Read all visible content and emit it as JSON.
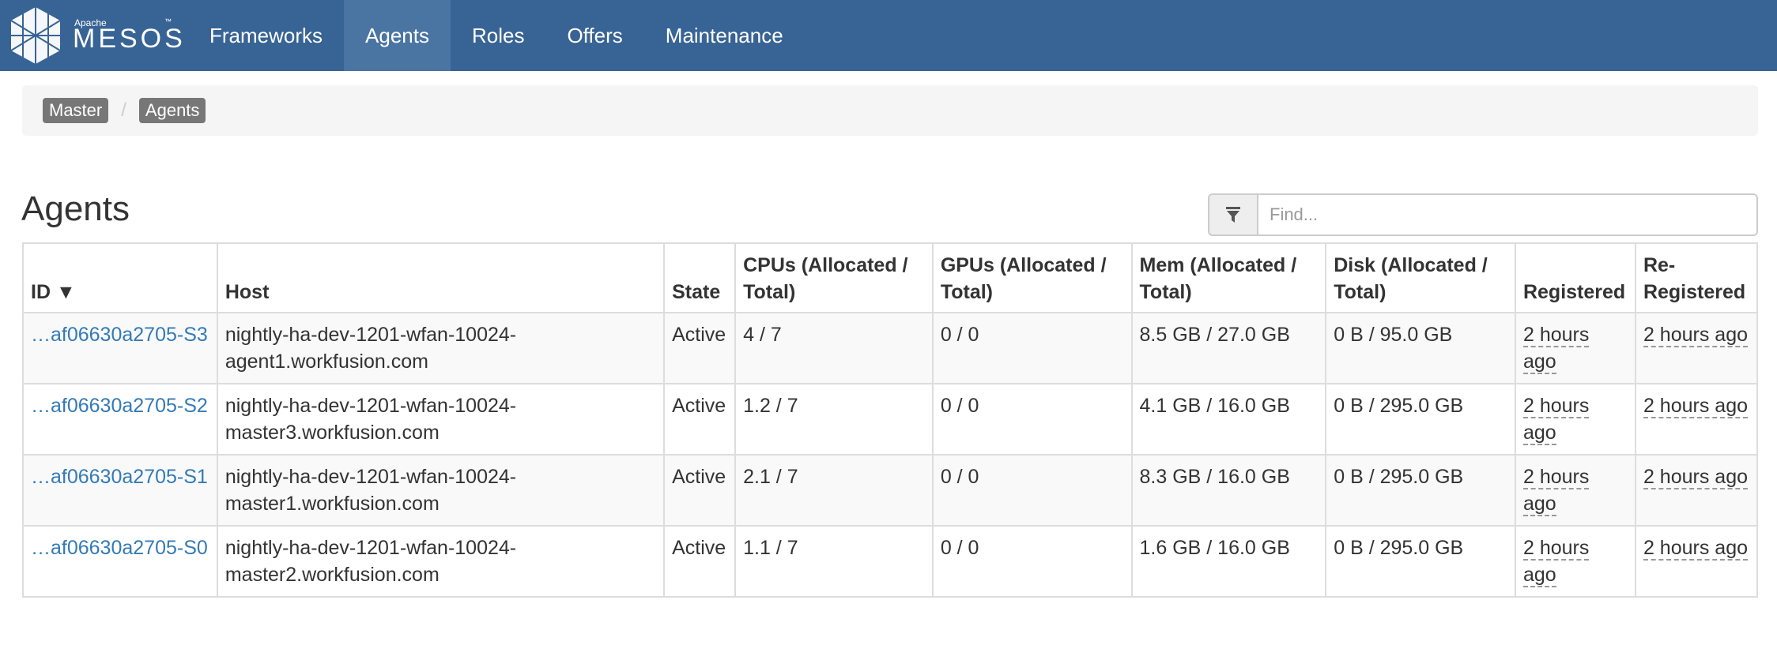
{
  "brand": {
    "apache": "Apache",
    "name": "MESOS",
    "trademark": "™"
  },
  "nav": {
    "items": [
      {
        "label": "Frameworks",
        "active": false
      },
      {
        "label": "Agents",
        "active": true
      },
      {
        "label": "Roles",
        "active": false
      },
      {
        "label": "Offers",
        "active": false
      },
      {
        "label": "Maintenance",
        "active": false
      }
    ]
  },
  "breadcrumb": {
    "items": [
      "Master",
      "Agents"
    ],
    "separator": "/"
  },
  "page": {
    "title": "Agents"
  },
  "search": {
    "placeholder": "Find...",
    "value": ""
  },
  "table": {
    "headers": {
      "id": "ID ▼",
      "host": "Host",
      "state": "State",
      "cpus": "CPUs (Allocated / Total)",
      "gpus": "GPUs (Allocated / Total)",
      "mem": "Mem (Allocated / Total)",
      "disk": "Disk (Allocated / Total)",
      "registered": "Registered",
      "reregistered": "Re-Registered"
    },
    "rows": [
      {
        "id": "…af06630a2705-S3",
        "host": "nightly-ha-dev-1201-wfan-10024-agent1.workfusion.com",
        "state": "Active",
        "cpus": "4 / 7",
        "gpus": "0 / 0",
        "mem": "8.5 GB / 27.0 GB",
        "disk": "0 B / 95.0 GB",
        "registered": "2 hours ago",
        "reregistered": "2 hours ago"
      },
      {
        "id": "…af06630a2705-S2",
        "host": "nightly-ha-dev-1201-wfan-10024-master3.workfusion.com",
        "state": "Active",
        "cpus": "1.2 / 7",
        "gpus": "0 / 0",
        "mem": "4.1 GB / 16.0 GB",
        "disk": "0 B / 295.0 GB",
        "registered": "2 hours ago",
        "reregistered": "2 hours ago"
      },
      {
        "id": "…af06630a2705-S1",
        "host": "nightly-ha-dev-1201-wfan-10024-master1.workfusion.com",
        "state": "Active",
        "cpus": "2.1 / 7",
        "gpus": "0 / 0",
        "mem": "8.3 GB / 16.0 GB",
        "disk": "0 B / 295.0 GB",
        "registered": "2 hours ago",
        "reregistered": "2 hours ago"
      },
      {
        "id": "…af06630a2705-S0",
        "host": "nightly-ha-dev-1201-wfan-10024-master2.workfusion.com",
        "state": "Active",
        "cpus": "1.1 / 7",
        "gpus": "0 / 0",
        "mem": "1.6 GB / 16.0 GB",
        "disk": "0 B / 295.0 GB",
        "registered": "2 hours ago",
        "reregistered": "2 hours ago"
      }
    ]
  },
  "icons": {
    "logo": "mesos-logo-icon",
    "filter": "filter-icon"
  },
  "colors": {
    "navbar": "#386495",
    "nav_active": "#4a75a3",
    "link": "#337ab7"
  }
}
